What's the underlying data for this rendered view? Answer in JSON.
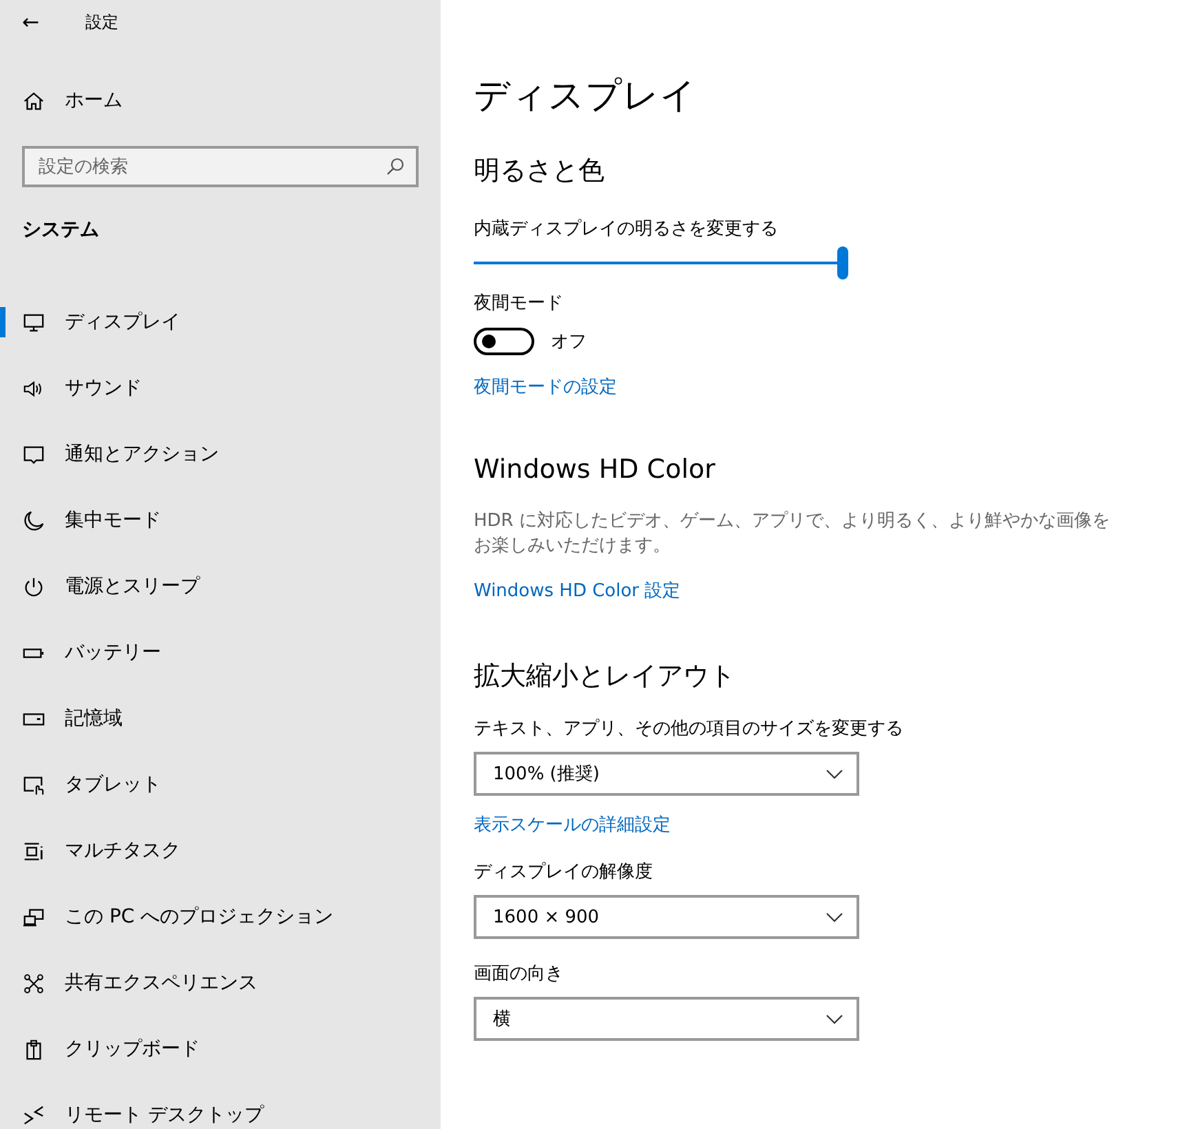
{
  "window": {
    "title": "設定",
    "back": "←"
  },
  "sidebar": {
    "home": "ホーム",
    "search": {
      "placeholder": "設定の検索"
    },
    "section": "システム",
    "items": [
      {
        "label": "ディスプレイ",
        "selected": true
      },
      {
        "label": "サウンド",
        "selected": false
      },
      {
        "label": "通知とアクション",
        "selected": false
      },
      {
        "label": "集中モード",
        "selected": false
      },
      {
        "label": "電源とスリープ",
        "selected": false
      },
      {
        "label": "バッテリー",
        "selected": false
      },
      {
        "label": "記憶域",
        "selected": false
      },
      {
        "label": "タブレット",
        "selected": false
      },
      {
        "label": "マルチタスク",
        "selected": false
      },
      {
        "label": "この PC へのプロジェクション",
        "selected": false
      },
      {
        "label": "共有エクスペリエンス",
        "selected": false
      },
      {
        "label": "クリップボード",
        "selected": false
      },
      {
        "label": "リモート デスクトップ",
        "selected": false
      }
    ]
  },
  "page": {
    "title": "ディスプレイ",
    "brightness": {
      "heading": "明るさと色",
      "slider_label": "内蔵ディスプレイの明るさを変更する",
      "level": 1.0,
      "night_label": "夜間モード",
      "night_on": false,
      "night_state": "オフ",
      "night_link": "夜間モードの設定"
    },
    "hd_color": {
      "heading": "Windows HD Color",
      "description": "HDR に対応したビデオ、ゲーム、アプリで、より明るく、より鮮やかな画像をお楽しみいただけます。",
      "link": "Windows HD Color 設定"
    },
    "layout": {
      "heading": "拡大縮小とレイアウト",
      "scale": {
        "label": "テキスト、アプリ、その他の項目のサイズを変更する",
        "value": "100% (推奨)"
      },
      "scale_link": "表示スケールの詳細設定",
      "resolution": {
        "label": "ディスプレイの解像度",
        "value": "1600 × 900"
      },
      "orientation": {
        "label": "画面の向き",
        "value": "横"
      }
    }
  }
}
